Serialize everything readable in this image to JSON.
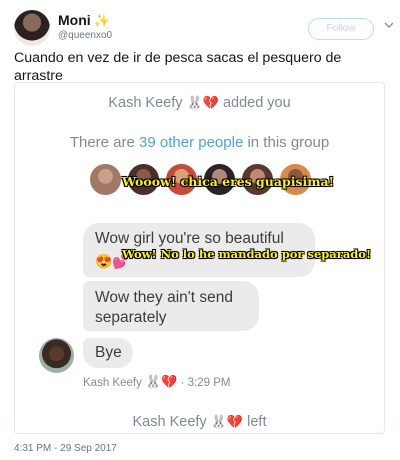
{
  "tweet": {
    "name": "Moni",
    "name_emoji": "✨",
    "handle": "@queenxo0",
    "follow_label": "Follow",
    "text": "Cuando en vez de ir de pesca sacas el pesquero de arrastre",
    "timestamp": "4:31 PM - 29 Sep 2017"
  },
  "card": {
    "sender_name": "Kash Keefy",
    "bunny_emoji": "🐰",
    "heart_emoji": "💔",
    "added_text": "added you",
    "count_prefix": "There are",
    "count_highlight": "39 other people",
    "count_suffix": "in this group",
    "messages": [
      {
        "text": "Wow girl you're so beautiful",
        "emojis": "😍💕"
      },
      {
        "text": "Wow they ain't send separately"
      },
      {
        "text": "Bye"
      }
    ],
    "meta_time": "3:29 PM",
    "left_text": "left",
    "group_avatar_colors": [
      "#a07a66",
      "#6b4a3e",
      "#c94a3a",
      "#3a3030",
      "#5a3830",
      "#d98a4a"
    ]
  },
  "captions": {
    "cap1": "Wooow! chica eres guapisima!",
    "cap2": "Wow! No lo he mandado por separado!"
  }
}
